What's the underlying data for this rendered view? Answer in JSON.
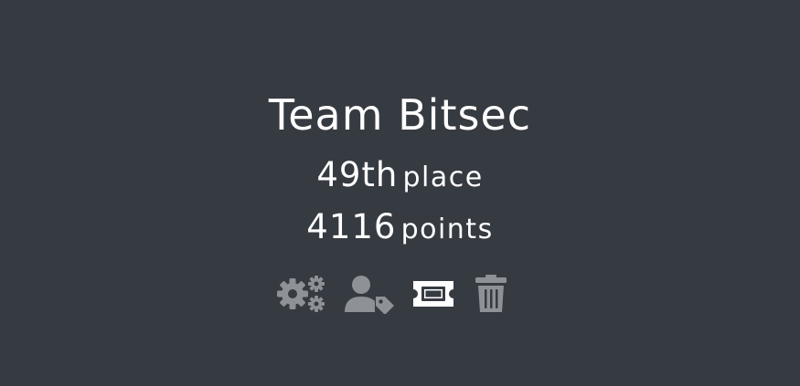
{
  "team": {
    "name": "Team Bitsec",
    "place_value": "49th",
    "place_unit": "place",
    "points_value": "4116",
    "points_unit": "points"
  },
  "actions": [
    {
      "icon": "gears-icon",
      "color": "#8e9196"
    },
    {
      "icon": "user-tag-icon",
      "color": "#8e9196"
    },
    {
      "icon": "ticket-icon",
      "color": "#ffffff"
    },
    {
      "icon": "trash-icon",
      "color": "#8e9196"
    }
  ],
  "colors": {
    "background": "#363a41",
    "text": "#ffffff",
    "icon_muted": "#8e9196",
    "icon_active": "#ffffff"
  }
}
